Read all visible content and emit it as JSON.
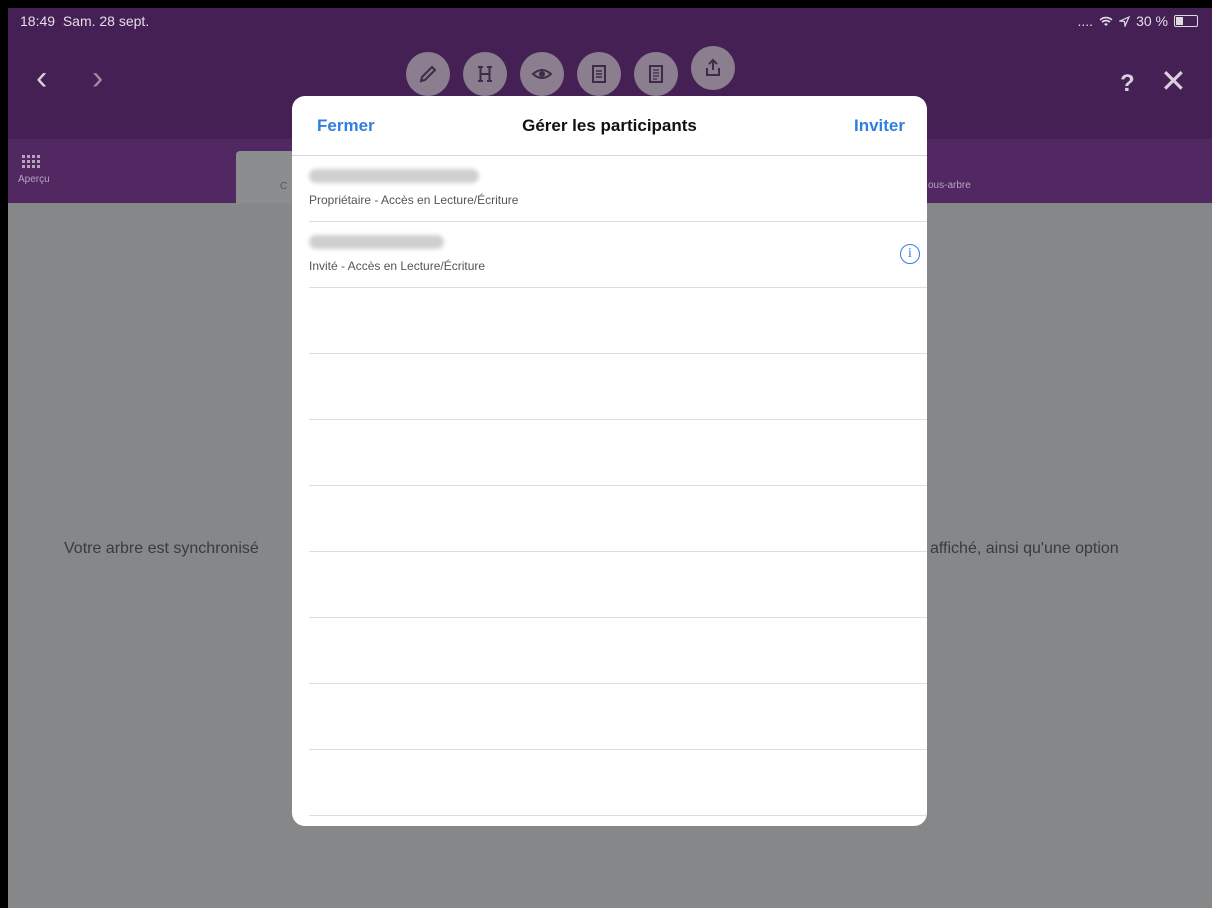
{
  "status": {
    "time": "18:49",
    "date": "Sam. 28 sept.",
    "battery": "30 %",
    "signal": "....",
    "wifi_icon": "wifi-icon",
    "location_icon": "location-icon"
  },
  "header": {
    "back_icon": "‹",
    "forward_icon": "›",
    "help_label": "?",
    "close_label": "✕",
    "tools": [
      "pencil-icon",
      "tree-icon",
      "eye-icon",
      "document-icon",
      "list-document-icon",
      "share-icon"
    ]
  },
  "tabs": {
    "apercu_label": "Aperçu",
    "partial_left": "C",
    "partial_right": "ous-arbre"
  },
  "background": {
    "left_text": "Votre arbre est synchronisé",
    "right_text": "affiché, ainsi qu'une option"
  },
  "modal": {
    "close_label": "Fermer",
    "title": "Gérer les participants",
    "invite_label": "Inviter",
    "participants": [
      {
        "role": "Propriétaire - Accès en Lecture/Écriture"
      },
      {
        "role": "Invité - Accès en Lecture/Écriture"
      }
    ],
    "empty_rows": 8
  },
  "colors": {
    "accent": "#2f7fe0",
    "header": "#452054",
    "overlay": "#868788"
  }
}
